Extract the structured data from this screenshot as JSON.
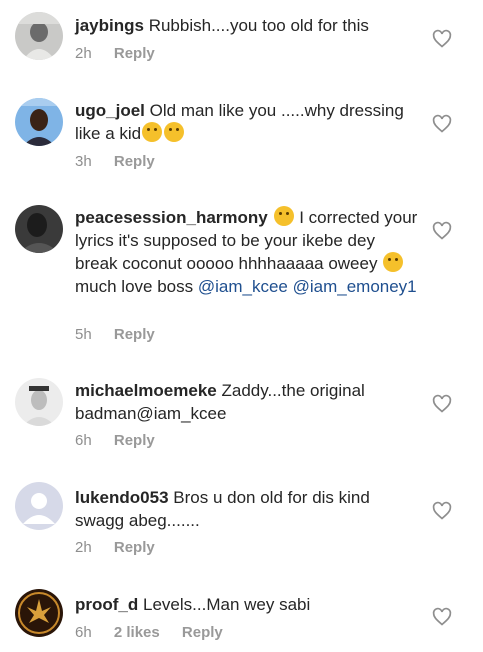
{
  "comments": [
    {
      "username": "jaybings",
      "text": "Rubbish....you too old for this",
      "time": "2h",
      "reply": "Reply"
    },
    {
      "username": "ugo_joel",
      "text": "Old man like you .....why dressing like a kid",
      "emoji": "thinking-face",
      "time": "3h",
      "reply": "Reply"
    },
    {
      "username": "peacesession_harmony",
      "text_a": "I corrected your lyrics it's supposed to be your ikebe dey break coconut ooooo  hhhhaaaaa oweey",
      "text_b": " much love boss ",
      "mention1": "@iam_kcee",
      "mention2": "@iam_emoney1",
      "emoji": "tears-of-joy",
      "time": "5h",
      "reply": "Reply"
    },
    {
      "username": "michaelmoemeke",
      "text": "Zaddy...the original badman@iam_kcee",
      "time": "6h",
      "reply": "Reply"
    },
    {
      "username": "lukendo053",
      "text": "Bros u don old for dis  kind swagg abeg.......",
      "time": "2h",
      "reply": "Reply"
    },
    {
      "username": "proof_d",
      "text": "Levels...Man wey sabi",
      "time": "6h",
      "likes": "2 likes",
      "reply": "Reply"
    }
  ],
  "colors": {
    "text": "#262626",
    "meta": "#8e8e8e",
    "mention": "#1f4f8f"
  }
}
